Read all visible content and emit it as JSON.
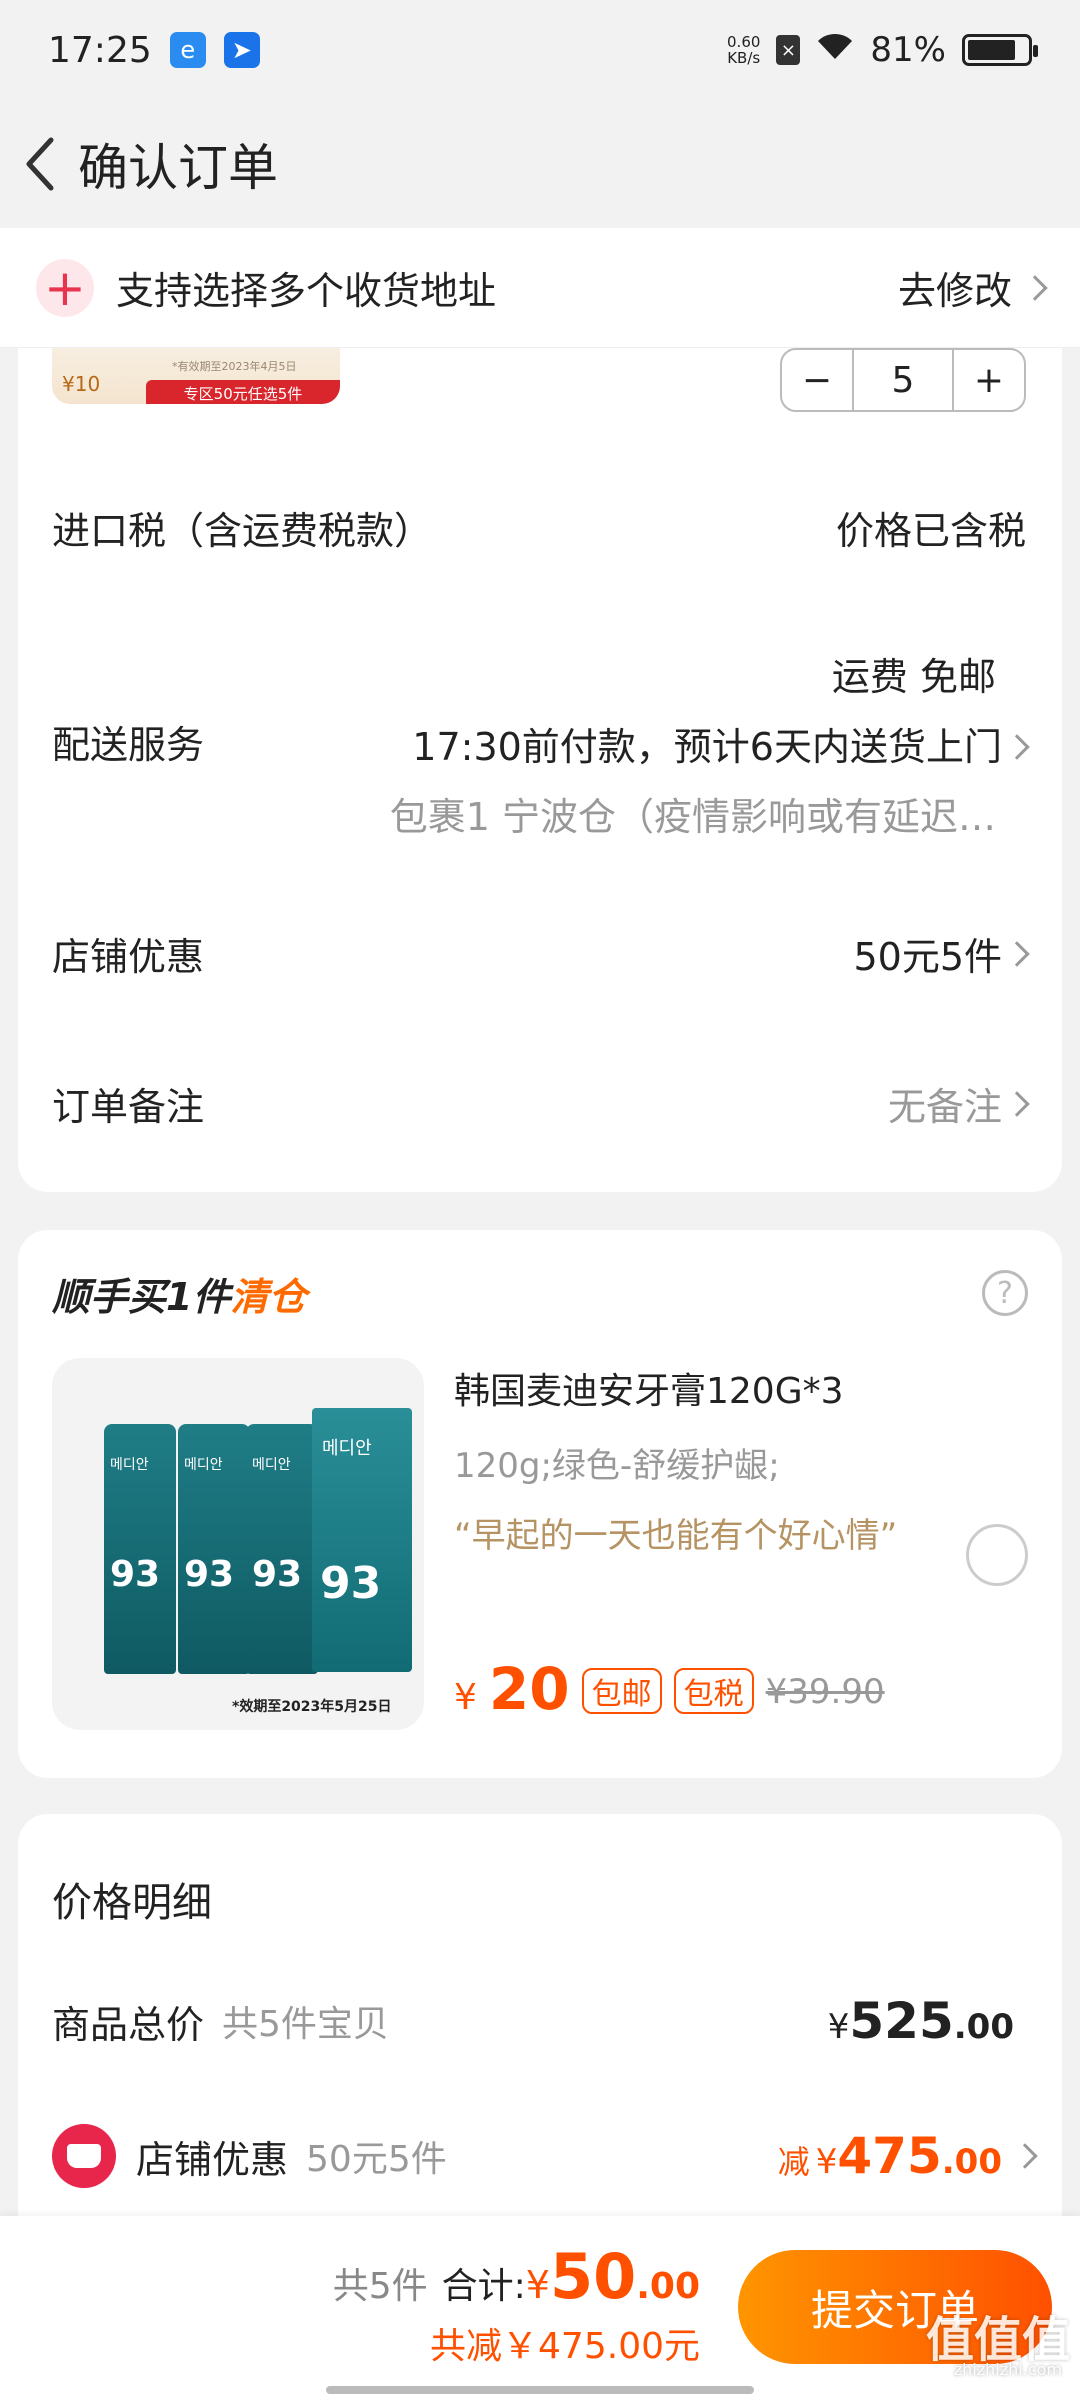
{
  "status_bar": {
    "time": "17:25",
    "speed_value": "0.60",
    "speed_unit": "KB/s",
    "battery": "81%",
    "battery_level": 0.81
  },
  "nav": {
    "title": "确认订单"
  },
  "address_banner": {
    "text": "支持选择多个收货地址",
    "action": "去修改"
  },
  "product_thumb": {
    "price": "¥10",
    "band": "专区50元任选5件",
    "note": "*有效期至2023年4月5日"
  },
  "quantity": {
    "minus": "−",
    "value": "5",
    "plus": "+"
  },
  "rows": {
    "tax_label": "进口税（含运费税款）",
    "tax_value": "价格已含税",
    "shipping_label": "配送服务",
    "shipping_fee": "运费 免邮",
    "shipping_eta": "17:30前付款，预计6天内送货上门",
    "shipping_pkg": "包裹1 宁波仓（疫情影响或有延迟…",
    "shop_discount_label": "店铺优惠",
    "shop_discount_value": "50元5件",
    "remark_label": "订单备注",
    "remark_value": "无备注"
  },
  "upsell": {
    "title_main": "顺手买1件",
    "title_accent": "清仓",
    "help": "?",
    "image_caption": "*效期至2023年5月25日",
    "image_brand": "메디안",
    "image_label": "93",
    "name": "韩国麦迪安牙膏120G*3",
    "spec": "120g;绿色-舒缓护龈;",
    "quote": "“早起的一天也能有个好心情”",
    "currency": "¥",
    "price": "20",
    "tag1": "包邮",
    "tag2": "包税",
    "original_price": "¥39.90"
  },
  "price_detail": {
    "title": "价格明细",
    "goods_label": "商品总价",
    "goods_sub": "共5件宝贝",
    "goods_yen": "¥",
    "goods_int": "525",
    "goods_dec": ".00",
    "shop_label": "店铺优惠",
    "shop_sub": "50元5件",
    "shop_prefix": "减",
    "shop_yen": "¥",
    "shop_int": "475",
    "shop_dec": ".00"
  },
  "bottom": {
    "count": "共5件",
    "total_label": "合计:",
    "yen": "¥",
    "total_int": "50",
    "total_dec": ".00",
    "saved": "共减￥475.00元",
    "submit": "提交订单"
  },
  "watermark": {
    "text": "值值值",
    "sub": "zhizhizhi.com"
  },
  "colors": {
    "accent": "#ff5000",
    "accent_gradient_start": "#ff9500",
    "shop_icon": "#e8254a",
    "quote": "#b69363"
  }
}
